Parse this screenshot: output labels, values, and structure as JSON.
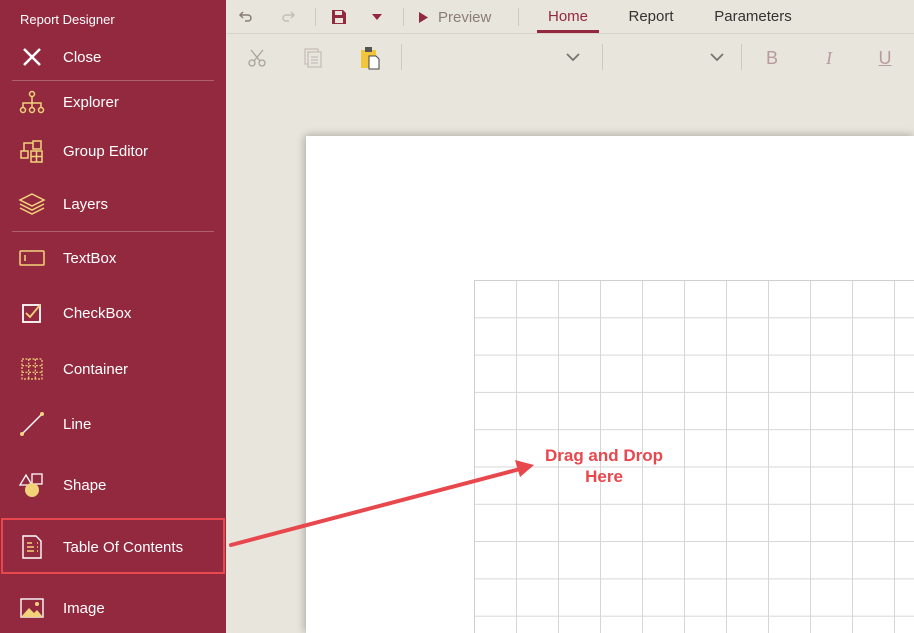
{
  "app": {
    "title": "Report Designer"
  },
  "sidebar": {
    "items": [
      {
        "label": "Close",
        "icon": "close-icon"
      },
      {
        "label": "Explorer",
        "icon": "explorer-icon"
      },
      {
        "label": "Group Editor",
        "icon": "group-editor-icon"
      },
      {
        "label": "Layers",
        "icon": "layers-icon"
      },
      {
        "label": "TextBox",
        "icon": "textbox-icon"
      },
      {
        "label": "CheckBox",
        "icon": "checkbox-icon"
      },
      {
        "label": "Container",
        "icon": "container-icon"
      },
      {
        "label": "Line",
        "icon": "line-icon"
      },
      {
        "label": "Shape",
        "icon": "shape-icon"
      },
      {
        "label": "Table Of Contents",
        "icon": "table-of-contents-icon"
      },
      {
        "label": "Image",
        "icon": "image-icon"
      }
    ]
  },
  "toolbar": {
    "preview_label": "Preview",
    "tabs": [
      {
        "label": "Home",
        "active": true
      },
      {
        "label": "Report",
        "active": false
      },
      {
        "label": "Parameters",
        "active": false
      }
    ],
    "bold_label": "B",
    "italic_label": "I",
    "underline_label": "U"
  },
  "canvas": {
    "drop_hint_line1": "Drag and Drop",
    "drop_hint_line2": "Here"
  },
  "colors": {
    "sidebar_bg": "#93293f",
    "accent": "#93293f",
    "highlight": "#e8474d",
    "icon_yellow": "#f3d37a"
  }
}
